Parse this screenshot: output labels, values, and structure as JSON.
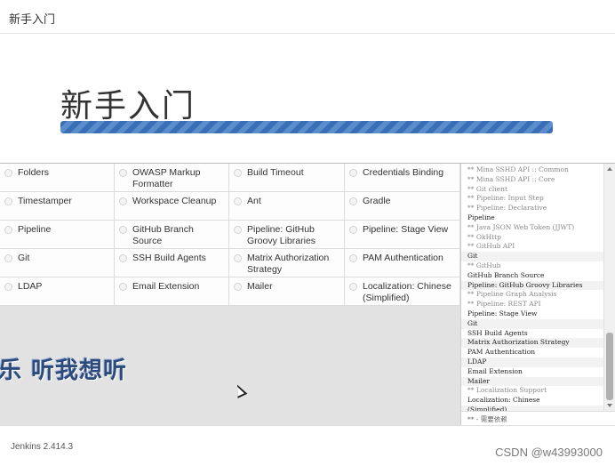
{
  "window": {
    "title": "新手入门"
  },
  "hero": {
    "heading": "新手入门",
    "progress": 1.0
  },
  "plugins": [
    [
      "Folders",
      "OWASP Markup Formatter",
      "Build Timeout",
      "Credentials Binding"
    ],
    [
      "Timestamper",
      "Workspace Cleanup",
      "Ant",
      "Gradle"
    ],
    [
      "Pipeline",
      "GitHub Branch Source",
      "Pipeline: GitHub Groovy Libraries",
      "Pipeline: Stage View"
    ],
    [
      "Git",
      "SSH Build Agents",
      "Matrix Authorization Strategy",
      "PAM Authentication"
    ],
    [
      "LDAP",
      "Email Extension",
      "Mailer",
      "Localization: Chinese (Simplified)"
    ]
  ],
  "overlay_text": "乐 听我想听",
  "log": [
    {
      "text": "** Mina SSHD API :: Common",
      "kind": "dep"
    },
    {
      "text": "** Mina SSHD API :: Core",
      "kind": "dep"
    },
    {
      "text": "** Git client",
      "kind": "dep"
    },
    {
      "text": "** Pipeline: Input Step",
      "kind": "dep"
    },
    {
      "text": "** Pipeline: Declarative",
      "kind": "dep"
    },
    {
      "text": "Pipeline",
      "kind": "main"
    },
    {
      "text": "** Java JSON Web Token (JJWT)",
      "kind": "dep"
    },
    {
      "text": "** OkHttp",
      "kind": "dep"
    },
    {
      "text": "** GitHub API",
      "kind": "dep"
    },
    {
      "text": "Git",
      "kind": "main"
    },
    {
      "text": "** GitHub",
      "kind": "dep"
    },
    {
      "text": "GitHub Branch Source",
      "kind": "main"
    },
    {
      "text": "Pipeline: GitHub Groovy Libraries",
      "kind": "main"
    },
    {
      "text": "** Pipeline Graph Analysis",
      "kind": "dep"
    },
    {
      "text": "** Pipeline: REST API",
      "kind": "dep"
    },
    {
      "text": "Pipeline: Stage View",
      "kind": "main"
    },
    {
      "text": "Git",
      "kind": "main"
    },
    {
      "text": "SSH Build Agents",
      "kind": "main"
    },
    {
      "text": "Matrix Authorization Strategy",
      "kind": "main"
    },
    {
      "text": "PAM Authentication",
      "kind": "main"
    },
    {
      "text": "LDAP",
      "kind": "main"
    },
    {
      "text": "Email Extension",
      "kind": "main"
    },
    {
      "text": "Mailer",
      "kind": "main"
    },
    {
      "text": "** Localization Support",
      "kind": "dep"
    },
    {
      "text": "Localization: Chinese",
      "kind": "main"
    },
    {
      "text": "(Simplified)",
      "kind": "main"
    }
  ],
  "legend": "** - 需要依赖",
  "footer": {
    "version": "Jenkins 2.414.3",
    "watermark": "CSDN @w43993000"
  }
}
